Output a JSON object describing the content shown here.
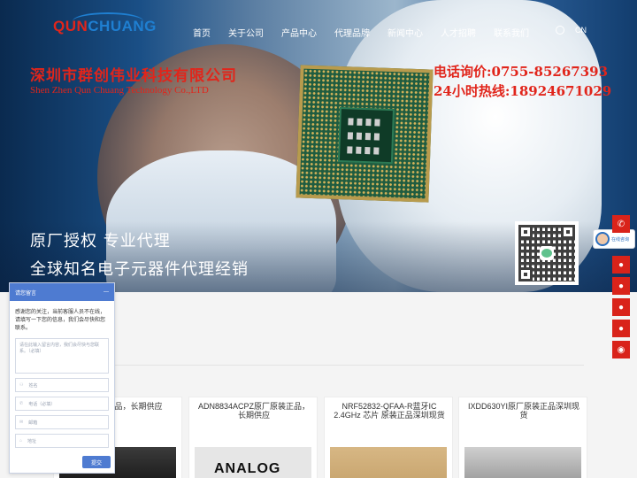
{
  "logo": {
    "part1": "QUN",
    "part2": "CHUANG"
  },
  "nav": {
    "items": [
      "首页",
      "关于公司",
      "产品中心",
      "代理品牌",
      "新闻中心",
      "人才招聘",
      "联系我们"
    ],
    "lang": "CN"
  },
  "banner": {
    "company_cn": "深圳市群创伟业科技有限公司",
    "company_en": "Shen Zhen Qun Chuang Technology Co.,LTD",
    "phone": "电话询价:0755-85267393",
    "hotline": "24小时热线:18924671029",
    "slogan1": "原厂授权 专业代理",
    "slogan2": "全球知名电子元器件代理经销"
  },
  "side_service": {
    "online_label": "在线咨询"
  },
  "products": [
    {
      "title": "原厂原装正品，长期供应"
    },
    {
      "title": "ADN8834ACPZ原厂原装正品，长期供应",
      "img_text": "ANALOG"
    },
    {
      "title": "NRF52832-QFAA-R蓝牙IC 2.4GHz 芯片 原装正品深圳现货"
    },
    {
      "title": "IXDD630YI原厂原装正品深圳现货"
    }
  ],
  "chat": {
    "header": "请您留言",
    "minimize": "—",
    "message": "感谢您的关注，当前客服人员不在线，请填写一下您的信息，我们会尽快和您联系。",
    "textarea_placeholder": "请在此输入留言内容，我们会尽快与您联系。（必填）",
    "fields": [
      {
        "label": "姓名"
      },
      {
        "label": "电话（必填）"
      },
      {
        "label": "邮箱"
      },
      {
        "label": "地址"
      }
    ],
    "submit": "提交"
  },
  "colors": {
    "brand_red": "#e1251b",
    "brand_blue": "#1f7fd1",
    "chat_blue": "#4e7bd1"
  }
}
